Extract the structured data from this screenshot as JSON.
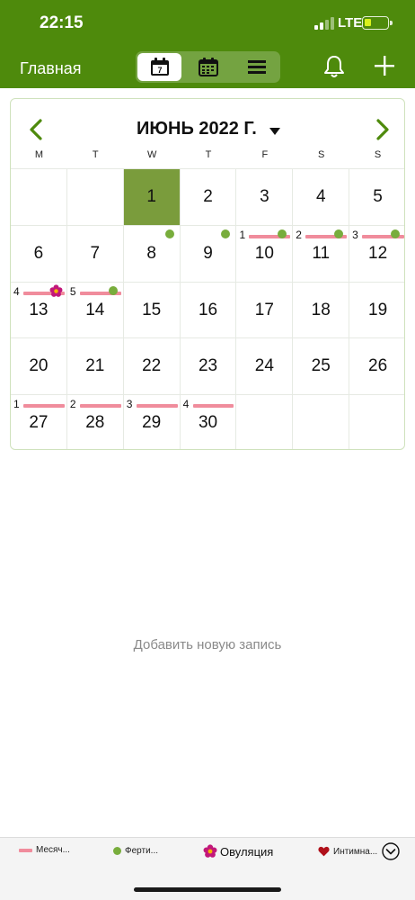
{
  "status": {
    "time": "22:15",
    "network": "LTE"
  },
  "header": {
    "title": "Главная",
    "view_icons": [
      "day-calendar-icon",
      "month-calendar-icon",
      "list-icon"
    ],
    "active_view": 0
  },
  "calendar": {
    "month_title": "ИЮНЬ 2022 Г.",
    "weekdays": [
      "M",
      "T",
      "W",
      "T",
      "F",
      "S",
      "S"
    ],
    "today": 1,
    "days": [
      {
        "day": "1"
      },
      {
        "day": "2"
      },
      {
        "day": "3"
      },
      {
        "day": "4"
      },
      {
        "day": "5"
      },
      {
        "day": "6"
      },
      {
        "day": "7"
      },
      {
        "day": "8",
        "fertile": true
      },
      {
        "day": "9",
        "fertile": true
      },
      {
        "day": "10",
        "cycle": "1",
        "period": true,
        "fertile": true
      },
      {
        "day": "11",
        "cycle": "2",
        "period": true,
        "fertile": true
      },
      {
        "day": "12",
        "cycle": "3",
        "period": true,
        "fertile": true
      },
      {
        "day": "13",
        "cycle": "4",
        "period": true,
        "ovulation": true
      },
      {
        "day": "14",
        "cycle": "5",
        "period": true,
        "fertile": true
      },
      {
        "day": "15"
      },
      {
        "day": "16"
      },
      {
        "day": "17"
      },
      {
        "day": "18"
      },
      {
        "day": "19"
      },
      {
        "day": "20"
      },
      {
        "day": "21"
      },
      {
        "day": "22"
      },
      {
        "day": "23"
      },
      {
        "day": "24"
      },
      {
        "day": "25"
      },
      {
        "day": "26"
      },
      {
        "day": "27",
        "cycle": "1",
        "period": true
      },
      {
        "day": "28",
        "cycle": "2",
        "period": true
      },
      {
        "day": "29",
        "cycle": "3",
        "period": true
      },
      {
        "day": "30",
        "cycle": "4",
        "period": true
      }
    ]
  },
  "empty_state": {
    "add_entry": "Добавить новую запись"
  },
  "legend": {
    "period": "Месяч...",
    "fertile": "Ферти...",
    "ovulation": "Овуляция",
    "intimacy": "Интимна..."
  },
  "colors": {
    "header": "#4e8a0c",
    "today": "#7a9c3c",
    "period": "#f08c9c",
    "fertile": "#78ad3c",
    "ovulation": "#c2187a"
  }
}
